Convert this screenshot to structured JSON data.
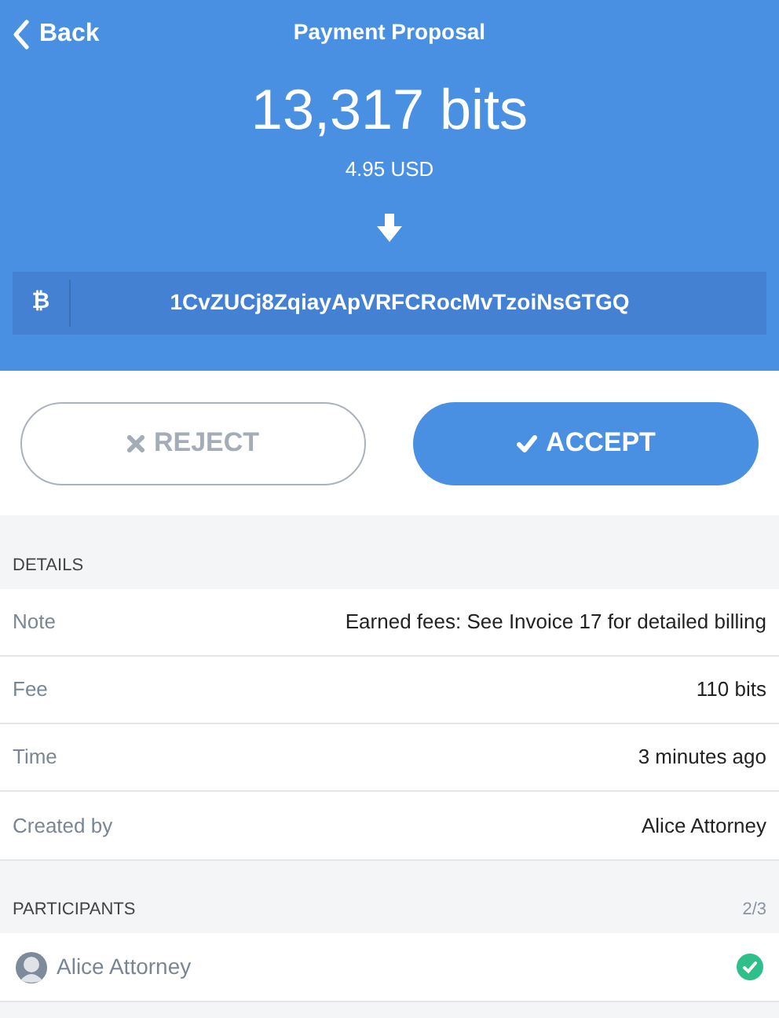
{
  "header": {
    "back": "Back",
    "title": "Payment Proposal",
    "amount": "13,317 bits",
    "fiat": "4.95 USD",
    "address_symbol": "₿",
    "address": "1CvZUCj8ZqiayApVRFCRocMvTzoiNsGTGQ"
  },
  "actions": [
    {
      "kind": "reject",
      "label": "REJECT"
    },
    {
      "kind": "accept",
      "label": "ACCEPT"
    }
  ],
  "details": {
    "heading": "DETAILS",
    "rows": [
      {
        "label": "Note",
        "value": "Earned fees: See Invoice 17 for detailed billing"
      },
      {
        "label": "Fee",
        "value": "110 bits"
      },
      {
        "label": "Time",
        "value": "3 minutes ago"
      },
      {
        "label": "Created by",
        "value": "Alice Attorney"
      }
    ]
  },
  "participants": {
    "heading": "PARTICIPANTS",
    "count": "2/3",
    "items": [
      {
        "name": "Alice Attorney",
        "approved": true
      }
    ]
  }
}
